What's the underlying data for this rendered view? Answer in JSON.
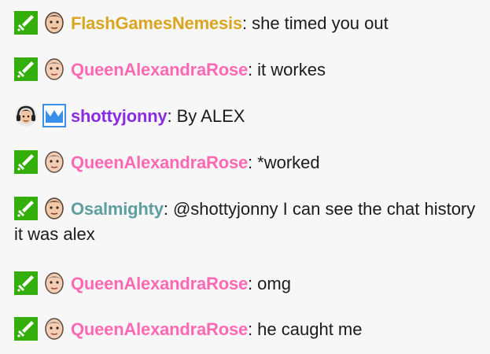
{
  "colors": {
    "moderator_badge": "#34ae0a",
    "broadcaster_badge": "#3a8fe8",
    "background": "#f7f7f7",
    "text": "#1b1b1b"
  },
  "messages": [
    {
      "username": "FlashGamesNemesis",
      "color": "#daa520",
      "text": "she timed you out",
      "badges": [
        "moderator-sword-icon",
        "face-avatar-icon"
      ]
    },
    {
      "username": "QueenAlexandraRose",
      "color": "#ff69b4",
      "text": "it workes",
      "badges": [
        "moderator-sword-icon",
        "face-avatar-icon"
      ]
    },
    {
      "username": "shottyjonny",
      "color": "#8a2be2",
      "text": "By ALEX",
      "badges": [
        "headset-avatar-icon",
        "crown-icon"
      ]
    },
    {
      "username": "QueenAlexandraRose",
      "color": "#ff69b4",
      "text": "*worked",
      "badges": [
        "moderator-sword-icon",
        "face-avatar-icon"
      ]
    },
    {
      "username": "Osalmighty",
      "color": "#5f9ea0",
      "text": "@shottyjonny I can see the chat history it was alex",
      "badges": [
        "moderator-sword-icon",
        "face-avatar-icon"
      ]
    },
    {
      "username": "QueenAlexandraRose",
      "color": "#ff69b4",
      "text": "omg",
      "badges": [
        "moderator-sword-icon",
        "face-avatar-icon"
      ]
    },
    {
      "username": "QueenAlexandraRose",
      "color": "#ff69b4",
      "text": "he caught me",
      "badges": [
        "moderator-sword-icon",
        "face-avatar-icon"
      ]
    }
  ]
}
